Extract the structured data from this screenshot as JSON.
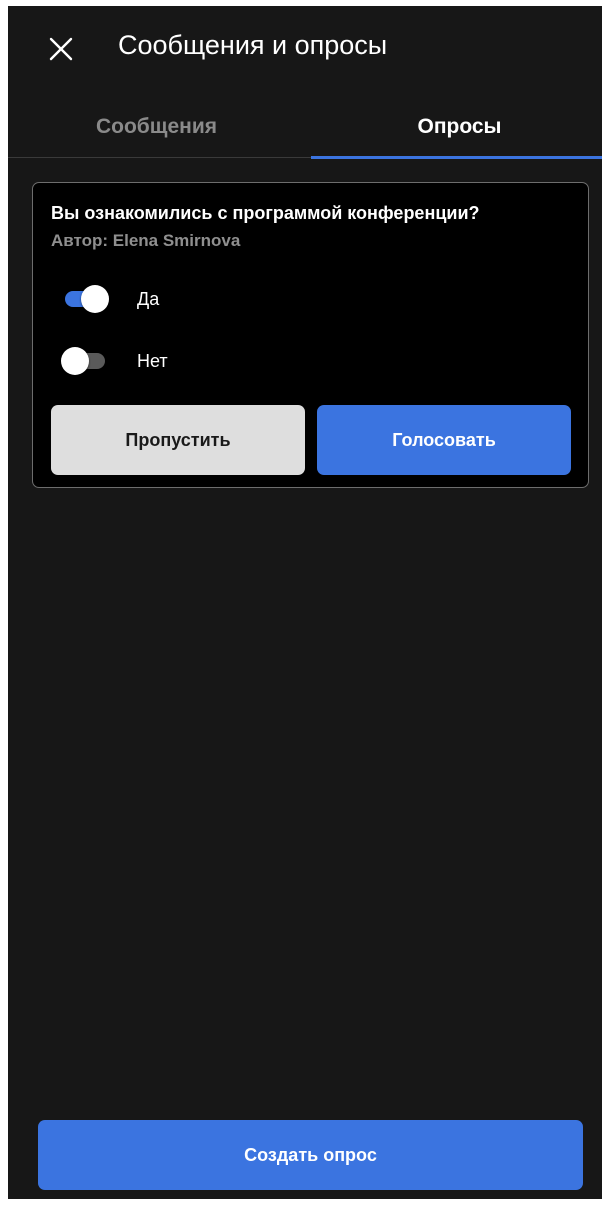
{
  "header": {
    "title": "Сообщения и опросы",
    "close_icon": "close-icon"
  },
  "tabs": [
    {
      "label": "Сообщения",
      "active": false
    },
    {
      "label": "Опросы",
      "active": true
    }
  ],
  "poll": {
    "question": "Вы ознакомились с программой конференции?",
    "author": "Автор: Elena Smirnova",
    "options": [
      {
        "label": "Да",
        "selected": true
      },
      {
        "label": "Нет",
        "selected": false
      }
    ],
    "skip_label": "Пропустить",
    "vote_label": "Голосовать"
  },
  "footer": {
    "create_label": "Создать опрос"
  },
  "colors": {
    "accent": "#3b74e0",
    "background": "#171717",
    "card": "#000000",
    "muted_text": "#8f8f8f",
    "secondary_button": "#dedede"
  }
}
